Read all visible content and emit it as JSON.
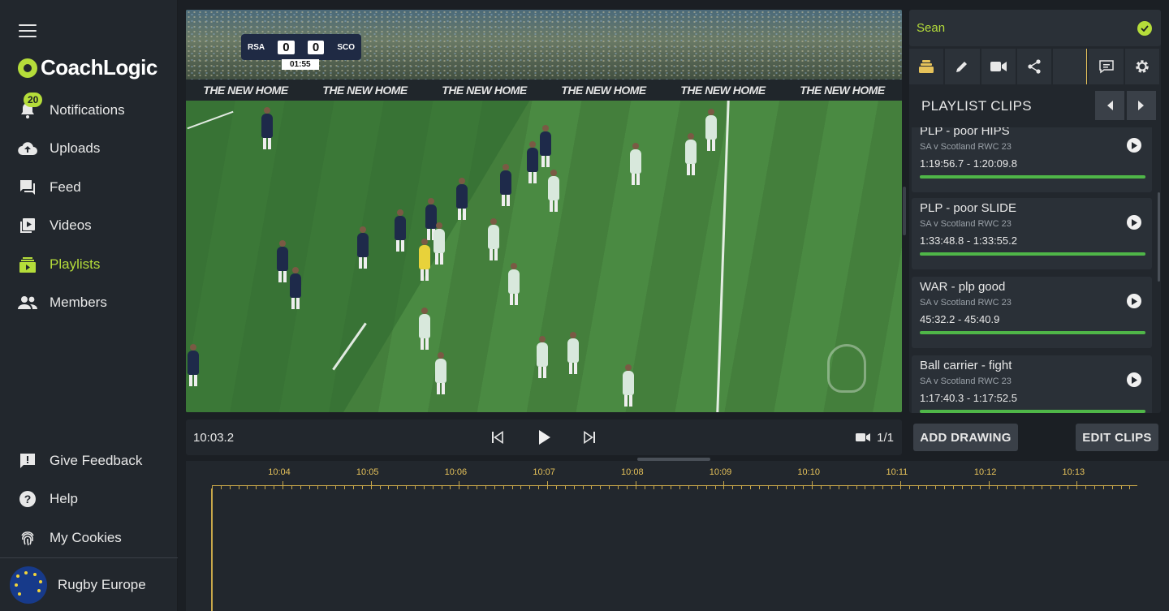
{
  "sidebar": {
    "brand": "CoachLogic",
    "notifications_badge": "20",
    "items": [
      {
        "label": "Notifications",
        "icon": "bell-icon"
      },
      {
        "label": "Uploads",
        "icon": "cloud-upload-icon"
      },
      {
        "label": "Feed",
        "icon": "chat-bubbles-icon"
      },
      {
        "label": "Videos",
        "icon": "video-library-icon"
      },
      {
        "label": "Playlists",
        "icon": "playlist-icon",
        "active": true
      },
      {
        "label": "Members",
        "icon": "people-icon"
      }
    ],
    "bottom_items": [
      {
        "label": "Give Feedback",
        "icon": "feedback-icon"
      },
      {
        "label": "Help",
        "icon": "help-icon"
      },
      {
        "label": "My Cookies",
        "icon": "fingerprint-icon"
      }
    ],
    "organization": "Rugby Europe",
    "accent_color": "#b5dd3a"
  },
  "video": {
    "scorebug": {
      "home": "RSA",
      "away": "SCO",
      "home_score": "0",
      "away_score": "0",
      "clock": "01:55"
    },
    "ad_text": "THE NEW HOME"
  },
  "player_controls": {
    "timecode": "10:03.2",
    "camera_count": "1/1"
  },
  "right_panel": {
    "user": "Sean",
    "title": "PLAYLIST CLIPS",
    "clips": [
      {
        "title": "PLP - poor HIPS",
        "subtitle": "SA v Scotland RWC 23",
        "range": "1:19:56.7 - 1:20:09.8",
        "progress": 1.0
      },
      {
        "title": "PLP - poor SLIDE",
        "subtitle": "SA v Scotland RWC 23",
        "range": "1:33:48.8 - 1:33:55.2",
        "progress": 1.0
      },
      {
        "title": "WAR - plp good",
        "subtitle": "SA v Scotland RWC 23",
        "range": "45:32.2 - 45:40.9",
        "progress": 1.0
      },
      {
        "title": "Ball carrier - fight",
        "subtitle": "SA v Scotland RWC 23",
        "range": "1:17:40.3 - 1:17:52.5",
        "progress": 1.0
      }
    ],
    "add_drawing_label": "ADD DRAWING",
    "edit_clips_label": "EDIT CLIPS"
  },
  "timeline": {
    "labels": [
      "10:04",
      "10:05",
      "10:06",
      "10:07",
      "10:08",
      "10:09",
      "10:10",
      "10:11",
      "10:12",
      "10:13"
    ],
    "color": "#c9a84a"
  }
}
